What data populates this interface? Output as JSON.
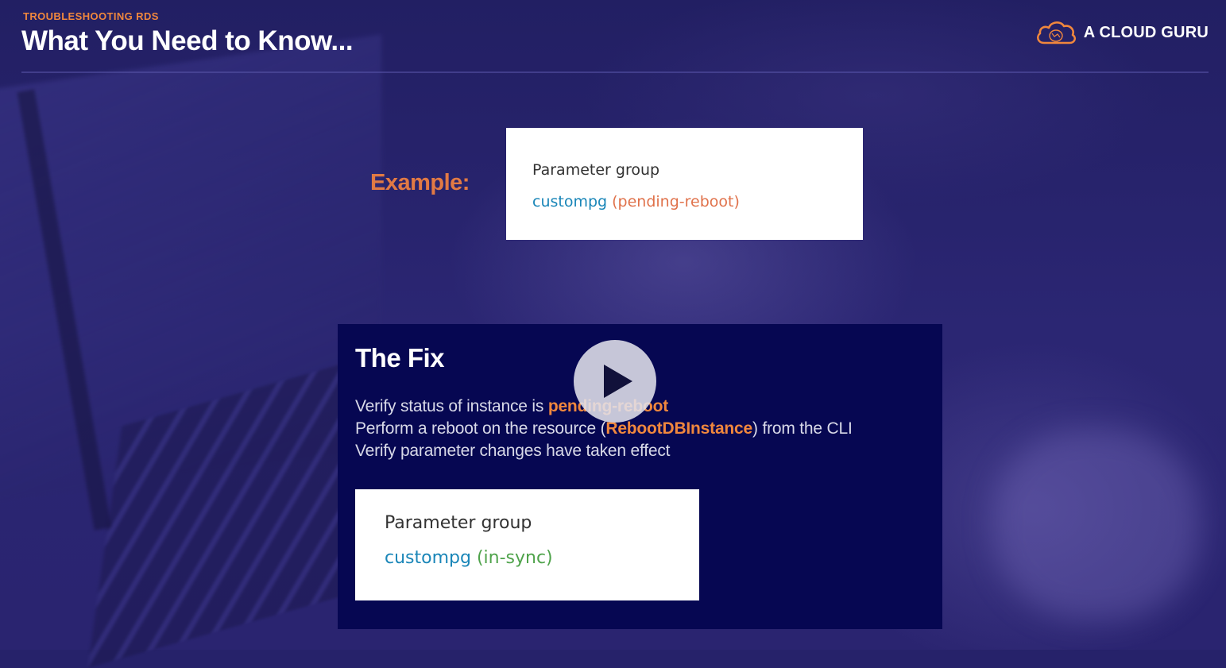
{
  "header": {
    "eyebrow": "TROUBLESHOOTING RDS",
    "title": "What You Need to Know..."
  },
  "brand": {
    "name": "A CLOUD GURU",
    "icon": "cloud-logo-icon",
    "accent_color": "#f0873d"
  },
  "example": {
    "label": "Example:",
    "card": {
      "label": "Parameter group",
      "name": "custompg",
      "status": "(pending-reboot)"
    }
  },
  "fix": {
    "title": "The Fix",
    "line1_prefix": "Verify status of instance is ",
    "line1_highlight": "pending-reboot",
    "line2_prefix": "Perform a reboot on the resource (",
    "line2_highlight": "RebootDBInstance",
    "line2_suffix": ") from the CLI",
    "line3": "Verify parameter changes have taken effect",
    "card": {
      "label": "Parameter group",
      "name": "custompg",
      "status": "(in-sync)"
    }
  },
  "player": {
    "play_icon": "play-icon"
  }
}
